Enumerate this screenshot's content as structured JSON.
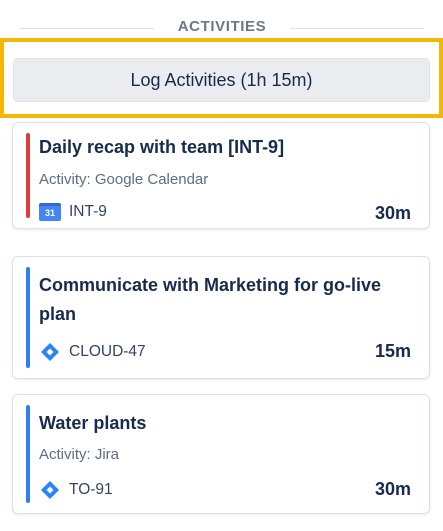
{
  "header": {
    "title": "ACTIVITIES"
  },
  "log_button": {
    "label": "Log Activities (1h 15m)"
  },
  "cards": [
    {
      "title": "Daily recap with team [INT-9]",
      "subtitle": "Activity: Google Calendar",
      "issue_key": "INT-9",
      "duration": "30m",
      "bar_color": "#e03c3c",
      "icon": "google-calendar-icon",
      "icon_text": "31"
    },
    {
      "title": "Communicate with Marketing for go-live plan",
      "issue_key": "CLOUD-47",
      "duration": "15m",
      "bar_color": "#2f80ed",
      "icon": "jira-icon"
    },
    {
      "title": "Water plants",
      "subtitle": "Activity: Jira",
      "issue_key": "TO-91",
      "duration": "30m",
      "bar_color": "#2f80ed",
      "icon": "jira-icon"
    }
  ]
}
